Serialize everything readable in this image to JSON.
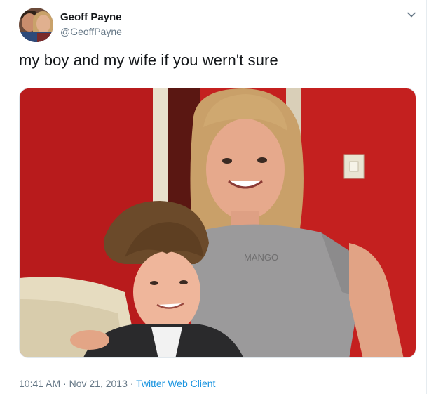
{
  "tweet": {
    "author_name": "Geoff Payne",
    "author_handle": "@GeoffPayne_",
    "text": "my boy and my wife if you wern't sure",
    "timestamp": "10:41 AM · Nov 21, 2013",
    "separator": " · ",
    "client": "Twitter Web Client",
    "photo_shirt_text": "MANGO"
  },
  "icons": {
    "menu": "chevron-down-icon"
  },
  "colors": {
    "link": "#1b95e0",
    "secondary_text": "#657786",
    "primary_text": "#14171a"
  }
}
